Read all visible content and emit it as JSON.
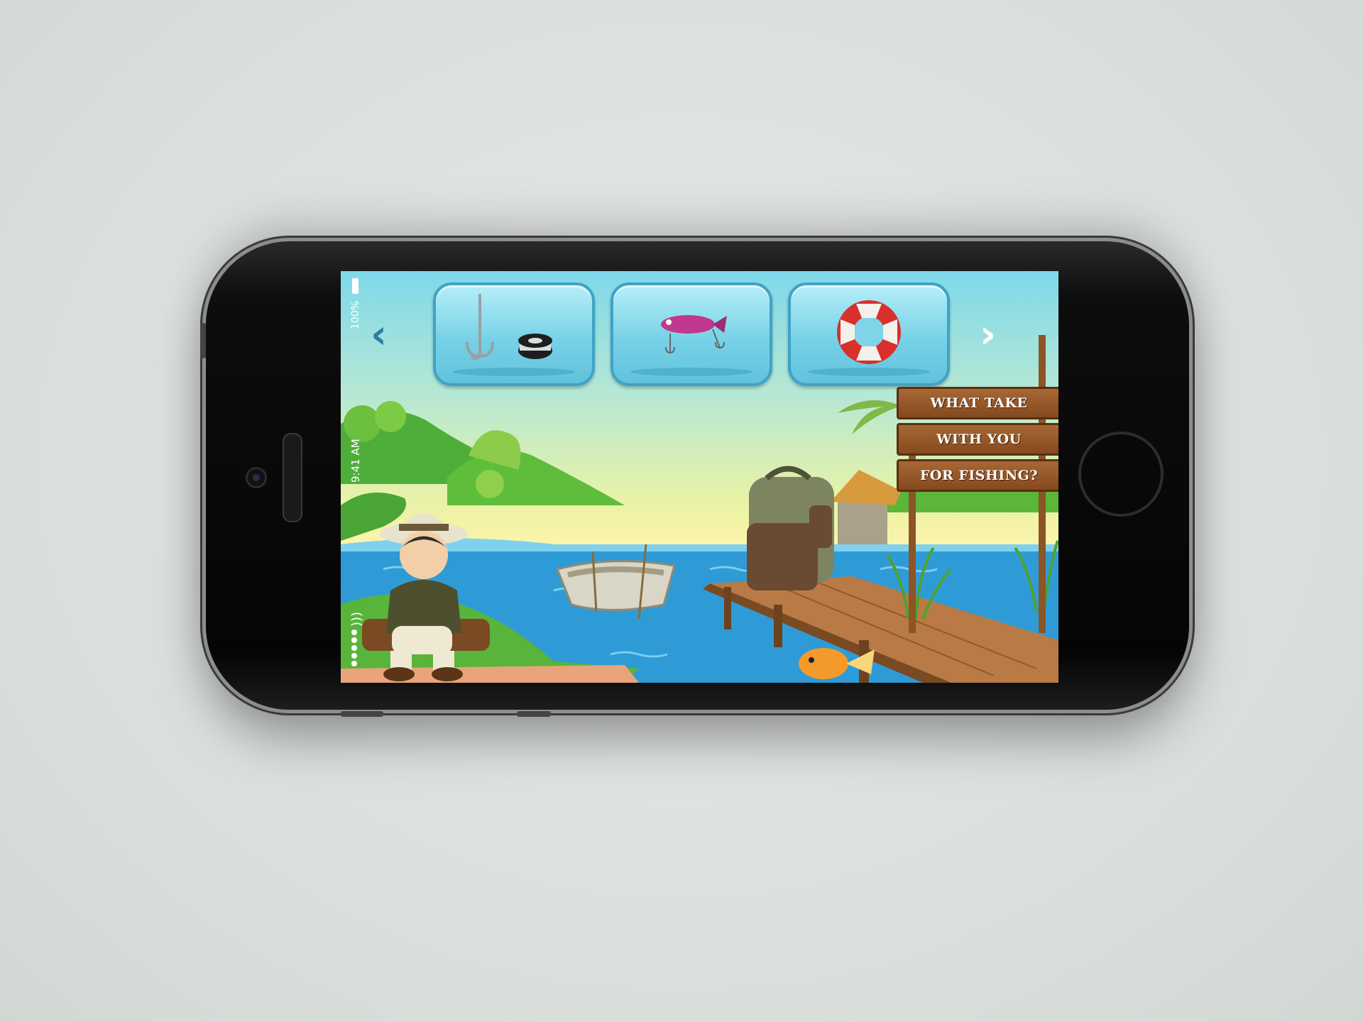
{
  "status_bar": {
    "battery_percent": "100%",
    "time": "9:41 AM"
  },
  "game": {
    "nav": {
      "back_arrow_icon": "chevron-left-icon",
      "forward_arrow_icon": "chevron-right-icon"
    },
    "item_slots": [
      {
        "icon": "hook-and-line-spool-icon"
      },
      {
        "icon": "fishing-lure-icon"
      },
      {
        "icon": "life-buoy-icon"
      }
    ],
    "sign": {
      "line1": "WHAT TAKE",
      "line2": "WITH YOU",
      "line3": "FOR  FISHING?"
    }
  },
  "colors": {
    "slot_fill": "#77d2e7",
    "slot_border": "#3fa3c7",
    "sign_wood": "#a76834",
    "water": "#2f9bd6"
  }
}
